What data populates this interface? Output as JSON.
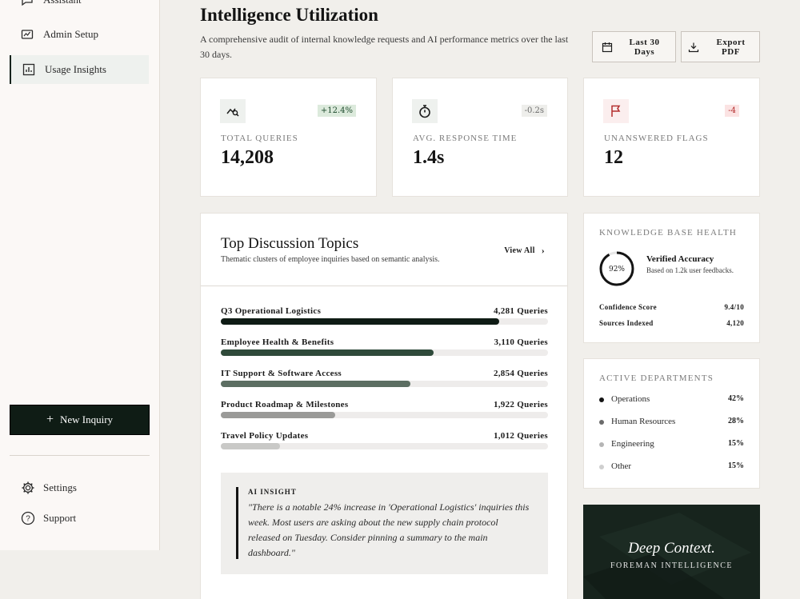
{
  "sidebar": {
    "items": [
      {
        "label": "Assistant",
        "icon": "chat-icon"
      },
      {
        "label": "Admin Setup",
        "icon": "admin-icon"
      },
      {
        "label": "Usage Insights",
        "icon": "chart-icon",
        "active": true
      }
    ],
    "new_inquiry": {
      "plus": "+",
      "label": "New Inquiry"
    },
    "settings_label": "Settings",
    "support_label": "Support"
  },
  "header": {
    "title": "Intelligence Utilization",
    "subtitle": "A comprehensive audit of internal knowledge requests and AI performance metrics over the last 30 days.",
    "date_range_label": "Last 30 Days",
    "export_label": "Export PDF"
  },
  "stats": [
    {
      "label": "TOTAL QUERIES",
      "value": "14,208",
      "badge": "+12.4%",
      "tone": "green",
      "icon": "trend-search-icon"
    },
    {
      "label": "AVG. RESPONSE TIME",
      "value": "1.4s",
      "badge": "-0.2s",
      "tone": "grey",
      "icon": "stopwatch-icon"
    },
    {
      "label": "UNANSWERED FLAGS",
      "value": "12",
      "badge": "-4",
      "tone": "red",
      "icon": "flag-icon"
    }
  ],
  "topics": {
    "title": "Top Discussion Topics",
    "subtitle": "Thematic clusters of employee inquiries based on semantic analysis.",
    "view_all": "View All",
    "items": [
      {
        "name": "Q3 Operational Logistics",
        "count": "4,281 Queries",
        "fill": 0.85,
        "color": "#0f1c15"
      },
      {
        "name": "Employee Health & Benefits",
        "count": "3,110 Queries",
        "fill": 0.65,
        "color": "#2f4a3a"
      },
      {
        "name": "IT Support & Software Access",
        "count": "2,854 Queries",
        "fill": 0.58,
        "color": "#5c6e62"
      },
      {
        "name": "Product Roadmap & Milestones",
        "count": "1,922 Queries",
        "fill": 0.35,
        "color": "#9a9a98"
      },
      {
        "name": "Travel Policy Updates",
        "count": "1,012 Queries",
        "fill": 0.18,
        "color": "#c9c9c7"
      }
    ],
    "insight_label": "AI INSIGHT",
    "insight_text": "\"There is a notable 24% increase in 'Operational Logistics' inquiries this week. Most users are asking about the new supply chain protocol released on Tuesday. Consider pinning a summary to the main dashboard.\""
  },
  "knowledge": {
    "label": "KNOWLEDGE BASE HEALTH",
    "ring_value": "92%",
    "ring_fraction": 0.92,
    "accuracy_title": "Verified Accuracy",
    "accuracy_sub": "Based on 1.2k user feedbacks.",
    "confidence_label": "Confidence Score",
    "confidence_value": "9.4/10",
    "sources_label": "Sources Indexed",
    "sources_value": "4,120"
  },
  "departments": {
    "label": "ACTIVE DEPARTMENTS",
    "items": [
      {
        "name": "Operations",
        "pct": "42%",
        "color": "#141414"
      },
      {
        "name": "Human Resources",
        "pct": "28%",
        "color": "#6b6b6b"
      },
      {
        "name": "Engineering",
        "pct": "15%",
        "color": "#b5b5b5"
      },
      {
        "name": "Other",
        "pct": "15%",
        "color": "#cfcfcf"
      }
    ]
  },
  "promo": {
    "title": "Deep Context.",
    "subtitle": "FOREMAN INTELLIGENCE"
  }
}
